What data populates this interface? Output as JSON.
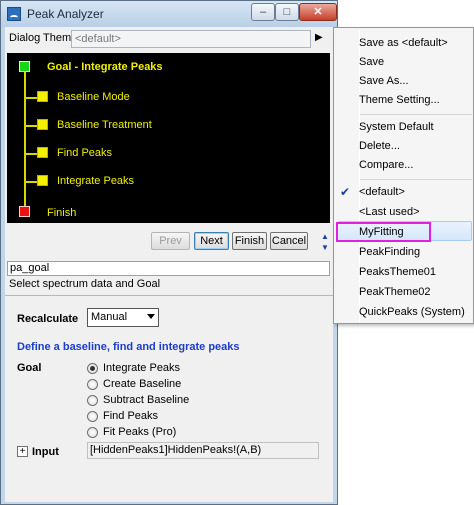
{
  "window": {
    "title": "Peak Analyzer",
    "min_label": "–",
    "max_label": "□",
    "close_label": "✕"
  },
  "theme": {
    "label": "Dialog Theme",
    "value": "<default>",
    "arrow": "▶"
  },
  "tree": {
    "goal": "Goal - Integrate Peaks",
    "steps": [
      "Baseline Mode",
      "Baseline Treatment",
      "Find Peaks",
      "Integrate Peaks"
    ],
    "finish": "Finish"
  },
  "nav": {
    "prev": "Prev",
    "next": "Next",
    "finish": "Finish",
    "cancel": "Cancel",
    "up": "▲",
    "down": "▼"
  },
  "page": {
    "name": "pa_goal",
    "description": "Select spectrum data and Goal"
  },
  "recalculate": {
    "label": "Recalculate",
    "value": "Manual"
  },
  "section": {
    "heading": "Define a baseline, find and integrate peaks",
    "goal_label": "Goal",
    "options": [
      "Integrate Peaks",
      "Create Baseline",
      "Subtract Baseline",
      "Find Peaks",
      "Fit Peaks (Pro)"
    ],
    "selected_index": 0
  },
  "input": {
    "expand": "+",
    "label": "Input",
    "value": "[HiddenPeaks1]HiddenPeaks!(A,B)"
  },
  "menu": {
    "group1": [
      "Save as <default>",
      "Save",
      "Save As...",
      "Theme Setting..."
    ],
    "group2": [
      "System Default",
      "Delete...",
      "Compare..."
    ],
    "themes": [
      "<default>",
      "<Last used>",
      "MyFitting",
      "PeakFinding",
      "PeaksTheme01",
      "PeakTheme02",
      "QuickPeaks (System)"
    ],
    "checked_index": 0,
    "highlighted_index": 2,
    "check_glyph": "✔"
  },
  "colors": {
    "goal_node": "#17d817",
    "step_node": "#f4f000",
    "finish_node": "#e81010",
    "highlight_outline": "#e020e0",
    "section_heading": "#1c3cc8"
  }
}
